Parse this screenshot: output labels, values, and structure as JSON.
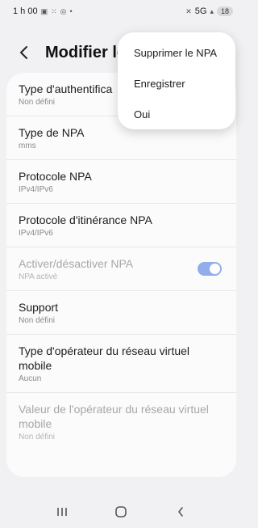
{
  "status_bar": {
    "time": "1 h 00",
    "left_icons": [
      "screenshot-icon",
      "grid-icon",
      "whatsapp-icon",
      "dot-icon"
    ],
    "network": "5G",
    "battery": "18"
  },
  "header": {
    "title": "Modifier le p"
  },
  "settings": [
    {
      "title": "Type d'authentifica",
      "subtitle": "Non défini"
    },
    {
      "title": "Type de NPA",
      "subtitle": "mms"
    },
    {
      "title": "Protocole NPA",
      "subtitle": "IPv4/IPv6"
    },
    {
      "title": "Protocole d'itinérance NPA",
      "subtitle": "IPv4/IPv6"
    },
    {
      "title": "Activer/désactiver NPA",
      "subtitle": "NPA activé",
      "disabled": true,
      "toggle_on": true
    },
    {
      "title": "Support",
      "subtitle": "Non défini"
    },
    {
      "title": "Type d'opérateur du réseau virtuel mobile",
      "subtitle": "Aucun"
    },
    {
      "title": "Valeur de l'opérateur du réseau virtuel mobile",
      "subtitle": "Non défini",
      "disabled": true
    }
  ],
  "menu": {
    "items": [
      "Supprimer le NPA",
      "Enregistrer",
      "Oui"
    ]
  },
  "colors": {
    "background": "#f1f1f3",
    "card": "#fbfbfb",
    "toggle": "#92aeea"
  }
}
